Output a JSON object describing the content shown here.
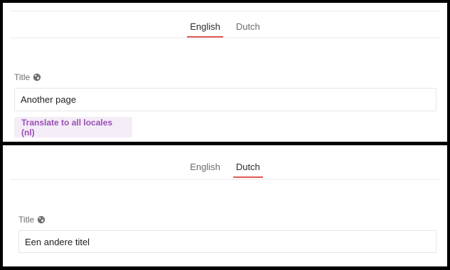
{
  "top_form": {
    "tabs": [
      {
        "label": "English",
        "active": true
      },
      {
        "label": "Dutch",
        "active": false
      }
    ],
    "title_label": "Title",
    "title_value": "Another page",
    "translate_button": "Translate to all locales (nl)"
  },
  "bottom_form": {
    "tabs": [
      {
        "label": "English",
        "active": false
      },
      {
        "label": "Dutch",
        "active": true
      }
    ],
    "title_label": "Title",
    "title_value": "Een andere titel"
  },
  "colors": {
    "accent_underline": "#e05a55",
    "translate_button_text": "#9a4fb6",
    "translate_button_bg": "#f4ecf7"
  },
  "icons": {
    "title_locale_icon": "globe-icon"
  }
}
